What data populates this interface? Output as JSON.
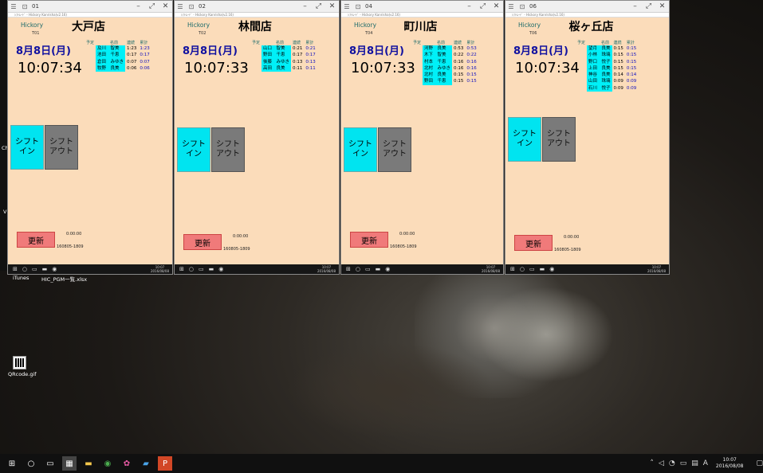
{
  "desktop": {
    "icons": [
      {
        "label": "iTunes",
        "icon": "itunes-icon"
      },
      {
        "label": "HIC_PGM一覧.xlsx",
        "icon": "excel-file-icon"
      },
      {
        "label": "QRcode.gif",
        "icon": "image-file-icon"
      }
    ],
    "left_labels": [
      "Ch",
      "V"
    ]
  },
  "common": {
    "logo": "Hickory",
    "date": "8月8日(月)",
    "col_plan": "予定",
    "col_name": "名前",
    "col_cont": "連続",
    "col_total": "累計",
    "btn_in": "シフト\nイン",
    "btn_out": "シフト\nアウト",
    "btn_update": "更新",
    "small_time": "0:00:00",
    "version": "160805-1809",
    "win_clock_time": "10:07",
    "win_clock_date": "2016/08/08"
  },
  "windows": [
    {
      "num": "01",
      "subtitle": "ｼﾌﾄﾑｰﾄﾞ - Hickory Kanrisha(v2.16)",
      "store": "大戸店",
      "code": "T01",
      "time": "10:07:34",
      "rows": [
        {
          "name": "及川　智美",
          "cont": "1:23",
          "total": "1:23"
        },
        {
          "name": "池田　千恵",
          "cont": "0:17",
          "total": "0:17"
        },
        {
          "name": "倉田　みゆき",
          "cont": "0:07",
          "total": "0:07"
        },
        {
          "name": "牧野　良美",
          "cont": "0:06",
          "total": "0:06"
        }
      ]
    },
    {
      "num": "02",
      "subtitle": "ｼﾌﾄﾑｰﾄﾞ - Hickory Kanrisha(v2.16)",
      "store": "林間店",
      "code": "T02",
      "time": "10:07:33",
      "rows": [
        {
          "name": "山口　智美",
          "cont": "0:21",
          "total": "0:21"
        },
        {
          "name": "野田　千恵",
          "cont": "0:17",
          "total": "0:17"
        },
        {
          "name": "後藤　みゆき",
          "cont": "0:13",
          "total": "0:13"
        },
        {
          "name": "高田　良美",
          "cont": "0:11",
          "total": "0:11"
        }
      ]
    },
    {
      "num": "04",
      "subtitle": "ｼﾌﾄﾑｰﾄﾞ - Hickory Kanrisha(v2.16)",
      "store": "町川店",
      "code": "T04",
      "time": "10:07:33",
      "rows": [
        {
          "name": "河野　良美",
          "cont": "0:53",
          "total": "0:53"
        },
        {
          "name": "木下　智美",
          "cont": "0:22",
          "total": "0:22"
        },
        {
          "name": "村本　千恵",
          "cont": "0:16",
          "total": "0:16"
        },
        {
          "name": "北村　みゆき",
          "cont": "0:16",
          "total": "0:16"
        },
        {
          "name": "北村　良美",
          "cont": "0:15",
          "total": "0:15"
        },
        {
          "name": "野田　千恵",
          "cont": "0:15",
          "total": "0:15"
        }
      ]
    },
    {
      "num": "06",
      "subtitle": "ｼﾌﾄﾑｰﾄﾞ - Hickory Kanrisha(v2.16)",
      "store": "桜ヶ丘店",
      "code": "T06",
      "time": "10:07:34",
      "rows": [
        {
          "name": "望月　良美",
          "cont": "0:15",
          "total": "0:15"
        },
        {
          "name": "小林　珠璃",
          "cont": "0:15",
          "total": "0:15"
        },
        {
          "name": "野口　悦子",
          "cont": "0:15",
          "total": "0:15"
        },
        {
          "name": "上田　良美",
          "cont": "0:15",
          "total": "0:15"
        },
        {
          "name": "神谷　良美",
          "cont": "0:14",
          "total": "0:14"
        },
        {
          "name": "山田　珠璃",
          "cont": "0:09",
          "total": "0:09"
        },
        {
          "name": "石川　悦子",
          "cont": "0:09",
          "total": "0:09"
        }
      ]
    }
  ],
  "taskbar": {
    "clock_time": "10:07",
    "clock_date": "2016/08/08",
    "items": [
      "start-icon",
      "search-icon",
      "task-view-icon",
      "app-icon",
      "file-explorer-icon",
      "chrome-icon",
      "app2-icon",
      "app3-icon",
      "powerpoint-icon"
    ]
  }
}
